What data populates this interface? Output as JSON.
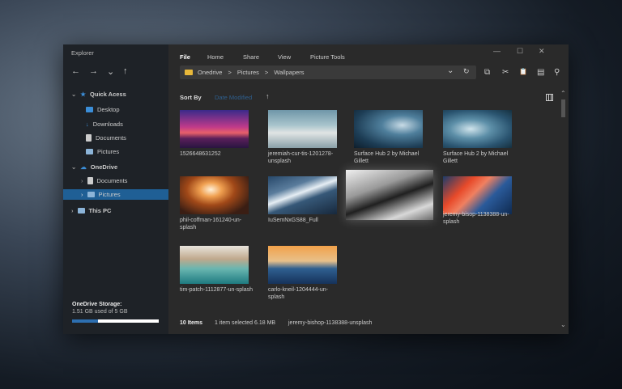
{
  "window": {
    "title": "Explorer",
    "min": "—",
    "max": "☐",
    "close": "✕"
  },
  "nav": {
    "back": "←",
    "forward": "→",
    "recent": "⌄",
    "up": "↑"
  },
  "sidebar": {
    "quick_access": "Quick Acess",
    "quick_items": [
      {
        "label": "Desktop"
      },
      {
        "label": "Downloads"
      },
      {
        "label": "Documents"
      },
      {
        "label": "Pictures"
      }
    ],
    "onedrive": "OneDrive",
    "onedrive_items": [
      {
        "label": "Documents"
      },
      {
        "label": "Pictures"
      }
    ],
    "this_pc": "This PC",
    "storage_title": "OneDrive Storage:",
    "storage_text": "1.51 GB used of 5 GB",
    "storage_fraction": 0.302
  },
  "menu": {
    "file": "File",
    "home": "Home",
    "share": "Share",
    "view": "View",
    "picture_tools": "Picture Tools"
  },
  "address": {
    "parts": [
      "Onedrive",
      ">",
      "Pictures",
      ">",
      "Wallpapers"
    ],
    "dropdown": "⌄",
    "refresh": "↻"
  },
  "toolbar": {
    "copy": "⧉",
    "cut": "✂",
    "paste": "📋",
    "clipboard": "▤",
    "search": "⚲"
  },
  "sort": {
    "label": "Sort By",
    "value": "Date Modified",
    "dir": "↑"
  },
  "files": [
    {
      "name": "1526648631252"
    },
    {
      "name": "jeremiah-cur-tis-1201278-unsplash"
    },
    {
      "name": "Surface Hub 2 by Michael Gillett"
    },
    {
      "name": "Surface Hub 2 by Michael Gillett"
    },
    {
      "name": "phil-coffman-161240-un-splash"
    },
    {
      "name": "IuSemNxGS88_Full"
    },
    {
      "name": ""
    },
    {
      "name": "jeremy-bisop-1138388-un-splash"
    },
    {
      "name": "tim-patch-1112877-un-splash"
    },
    {
      "name": "carlo-kneil-1204444-un-splash"
    }
  ],
  "status": {
    "count": "10 Items",
    "selected": "1 item selected 6.18 MB",
    "name": "jeremy-bishop-1138388-unsplash"
  },
  "accent": "#3b8ed8"
}
